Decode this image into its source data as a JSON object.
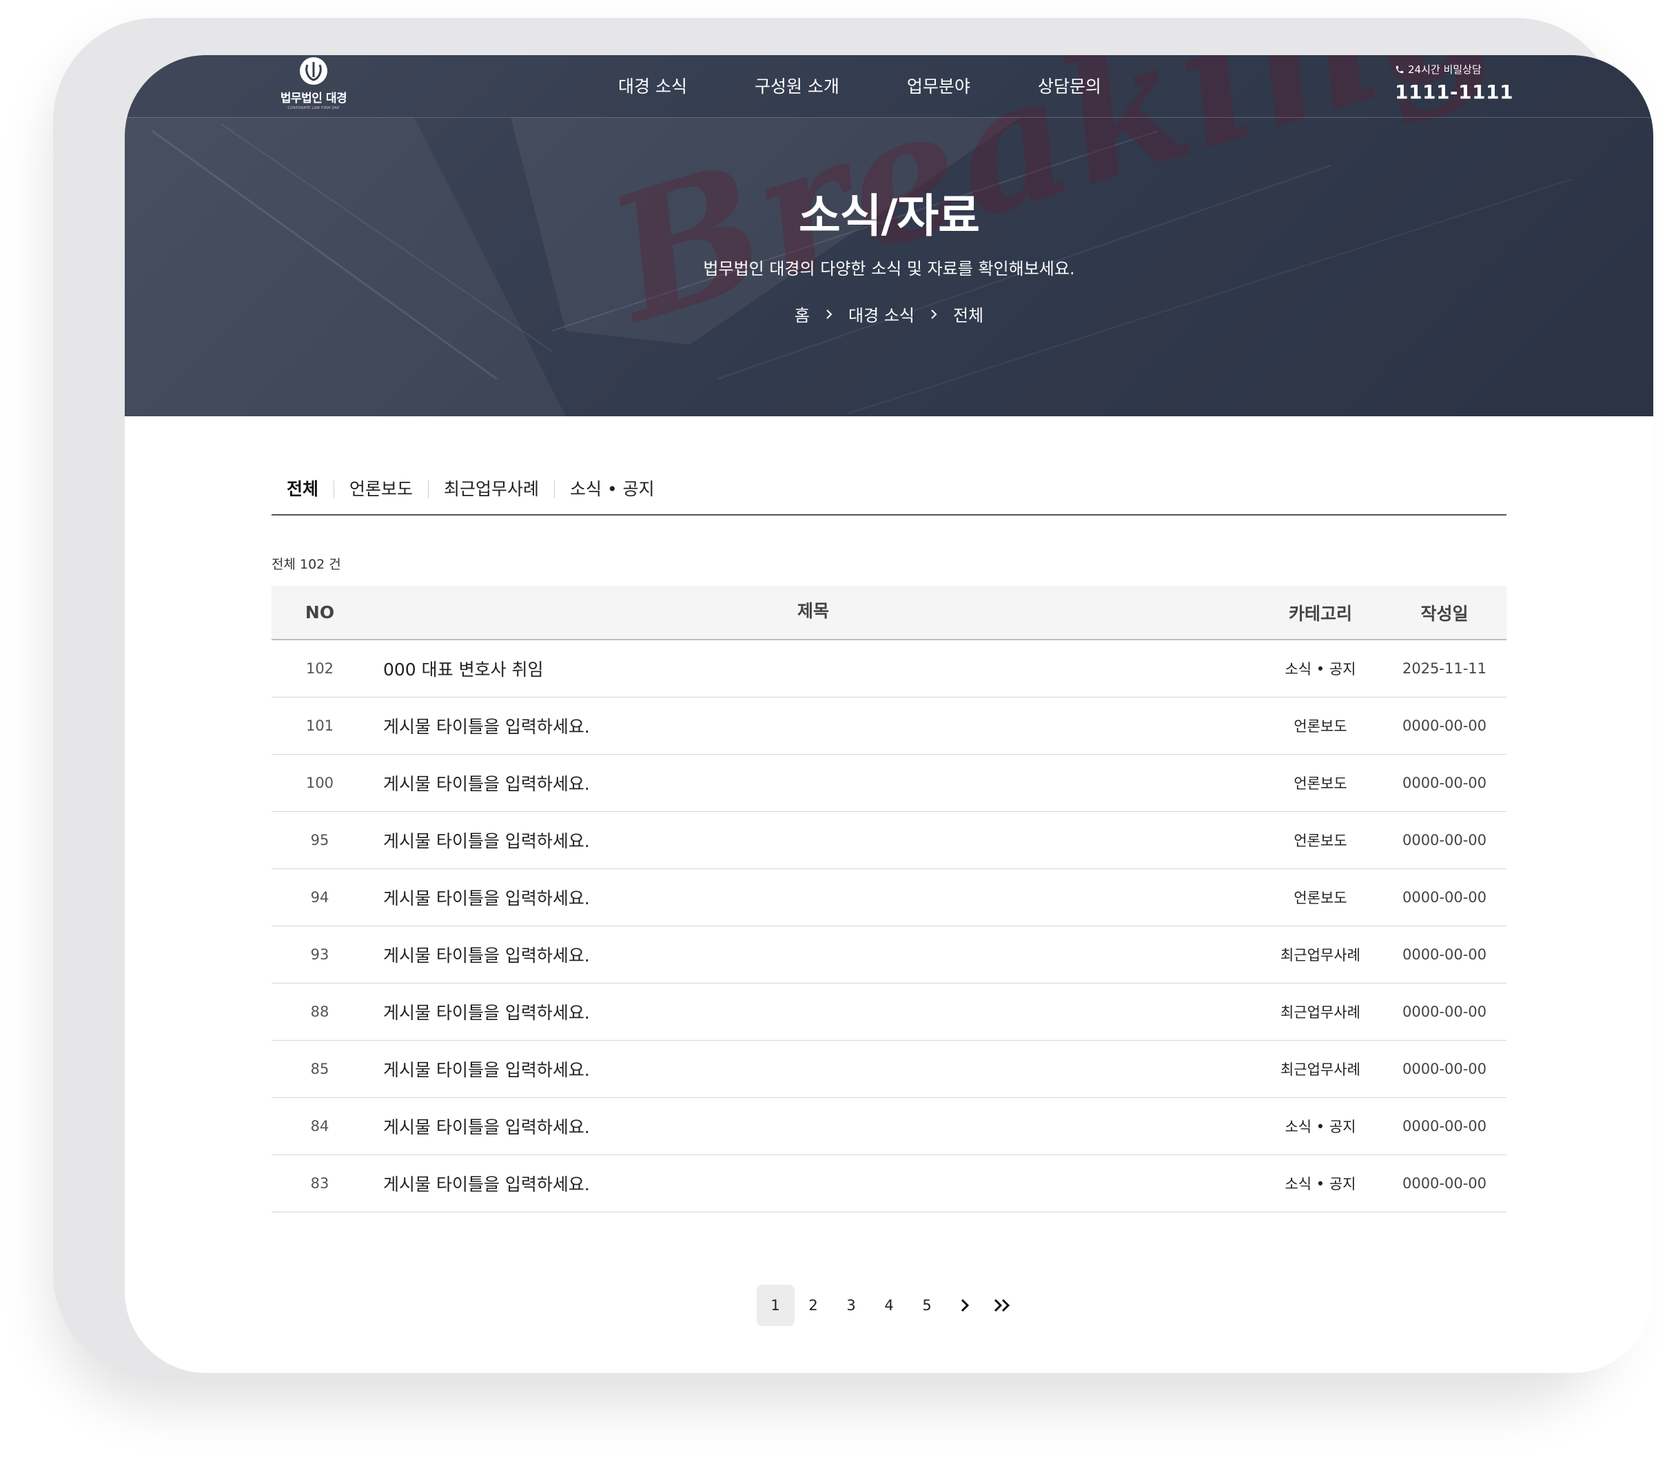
{
  "header": {
    "logo_text": "법무법인 대경",
    "logo_sub": "CORPORATE LAW FIRM DAE",
    "menu": [
      {
        "label": "대경 소식"
      },
      {
        "label": "구성원 소개"
      },
      {
        "label": "업무분야"
      },
      {
        "label": "상담문의"
      }
    ],
    "hotline_label": "24시간 비밀상담",
    "hotline_number": "1111-1111"
  },
  "hero": {
    "title": "소식/자료",
    "subtitle": "법무법인 대경의 다양한 소식 및 자료를 확인해보세요.",
    "watermark": "Breaking News",
    "breadcrumb": [
      "홈",
      "대경 소식",
      "전체"
    ]
  },
  "tabs": [
    {
      "label": "전체",
      "active": true
    },
    {
      "label": "언론보도"
    },
    {
      "label": "최근업무사례"
    },
    {
      "label": "소식 • 공지"
    }
  ],
  "board": {
    "total_text": "전체 102 건",
    "columns": {
      "no": "NO",
      "title": "제목",
      "category": "카테고리",
      "date": "작성일"
    },
    "rows": [
      {
        "no": "102",
        "title": "000 대표 변호사 취임",
        "category": "소식 • 공지",
        "date": "2025-11-11"
      },
      {
        "no": "101",
        "title": "게시물 타이틀을 입력하세요.",
        "category": "언론보도",
        "date": "0000-00-00"
      },
      {
        "no": "100",
        "title": "게시물 타이틀을 입력하세요.",
        "category": "언론보도",
        "date": "0000-00-00"
      },
      {
        "no": "95",
        "title": "게시물 타이틀을 입력하세요.",
        "category": "언론보도",
        "date": "0000-00-00"
      },
      {
        "no": "94",
        "title": "게시물 타이틀을 입력하세요.",
        "category": "언론보도",
        "date": "0000-00-00"
      },
      {
        "no": "93",
        "title": "게시물 타이틀을 입력하세요.",
        "category": "최근업무사례",
        "date": "0000-00-00"
      },
      {
        "no": "88",
        "title": "게시물 타이틀을 입력하세요.",
        "category": "최근업무사례",
        "date": "0000-00-00"
      },
      {
        "no": "85",
        "title": "게시물 타이틀을 입력하세요.",
        "category": "최근업무사례",
        "date": "0000-00-00"
      },
      {
        "no": "84",
        "title": "게시물 타이틀을 입력하세요.",
        "category": "소식 • 공지",
        "date": "0000-00-00"
      },
      {
        "no": "83",
        "title": "게시물 타이틀을 입력하세요.",
        "category": "소식 • 공지",
        "date": "0000-00-00"
      }
    ]
  },
  "pagination": {
    "pages": [
      "1",
      "2",
      "3",
      "4",
      "5"
    ],
    "current": "1",
    "icons": {
      "next": "chevron-right-icon",
      "last": "double-chevron-right-icon"
    }
  },
  "colors": {
    "hero_bg": "#343c4f",
    "watermark": "#5f1e32",
    "active_page_bg": "#ececec"
  }
}
